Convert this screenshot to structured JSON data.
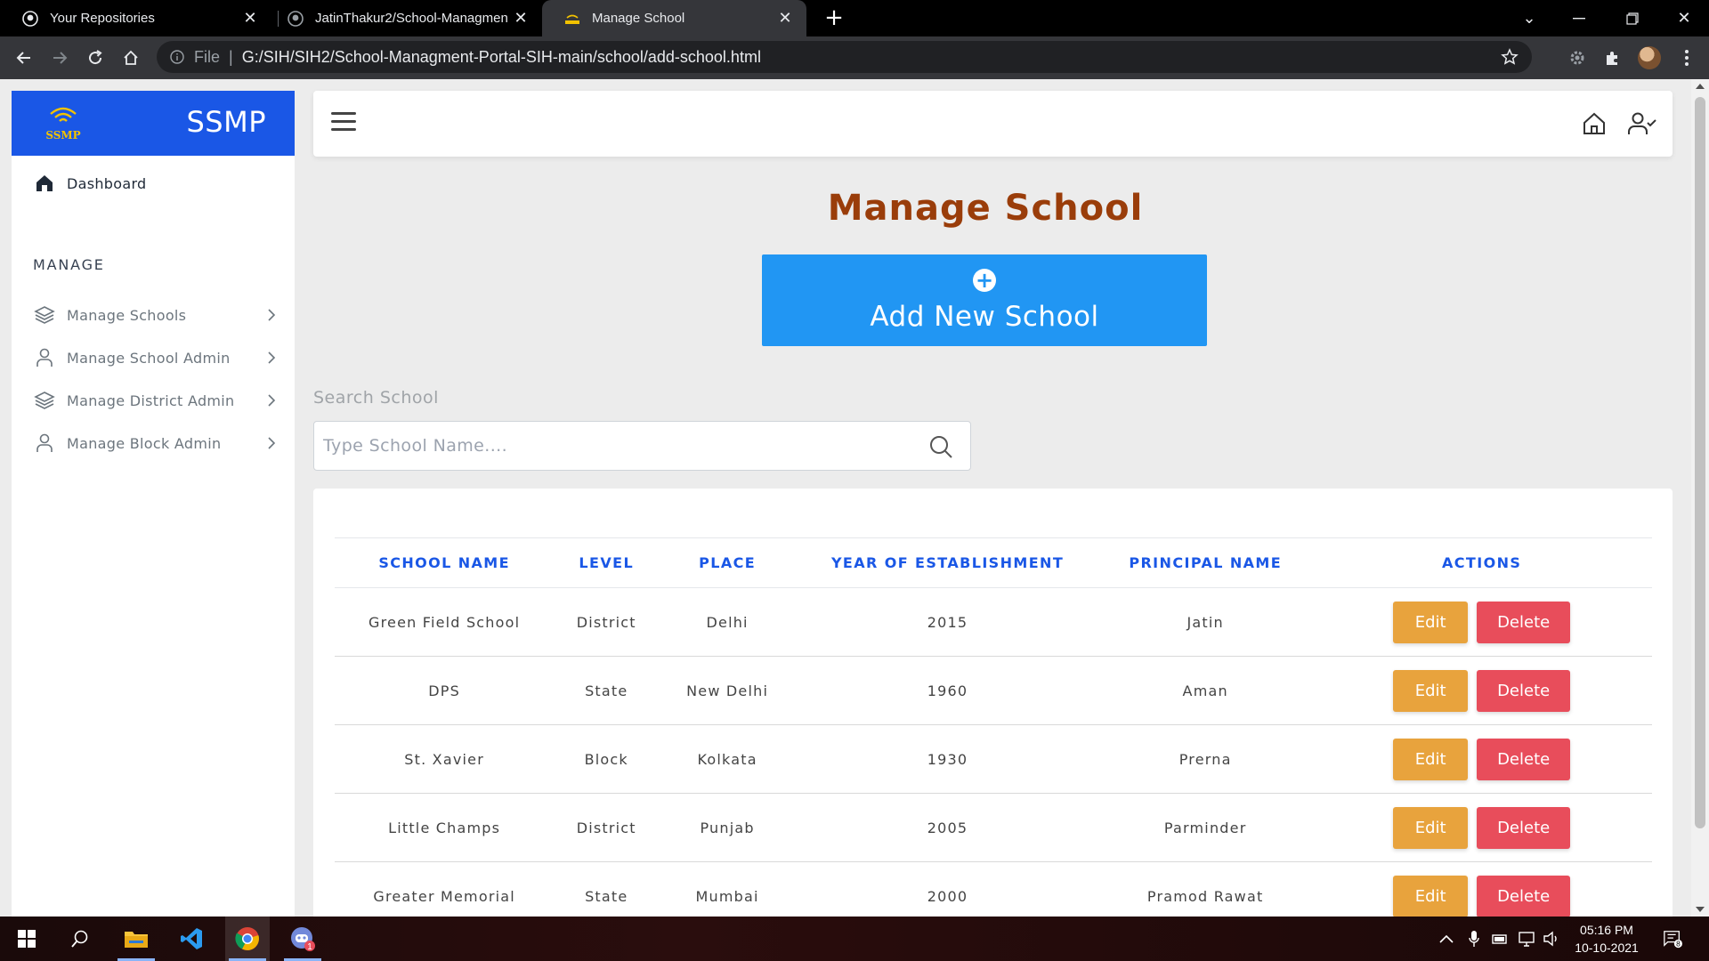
{
  "browser": {
    "tabs": [
      {
        "title": "Your Repositories",
        "icon": "github-icon"
      },
      {
        "title": "JatinThakur2/School-Managment",
        "icon": "github-icon"
      },
      {
        "title": "Manage School",
        "icon": "ssmp-favicon"
      }
    ],
    "protocol": "File",
    "url": "G:/SIH/SIH2/School-Managment-Portal-SIH-main/school/add-school.html"
  },
  "sidebar": {
    "brand": "SSMP",
    "logo_text": "SSMP",
    "dashboard": "Dashboard",
    "section": "MANAGE",
    "items": [
      {
        "label": "Manage Schools",
        "icon": "layers-icon"
      },
      {
        "label": "Manage School Admin",
        "icon": "user-icon"
      },
      {
        "label": "Manage District Admin",
        "icon": "layers-icon"
      },
      {
        "label": "Manage Block Admin",
        "icon": "user-icon"
      }
    ]
  },
  "main": {
    "title": "Manage School",
    "add_button": "Add New School",
    "search_label": "Search School",
    "search_placeholder": "Type School Name....",
    "table": {
      "headers": [
        "SCHOOL NAME",
        "LEVEL",
        "PLACE",
        "YEAR OF ESTABLISHMENT",
        "PRINCIPAL NAME",
        "ACTIONS"
      ],
      "rows": [
        [
          "Green Field School",
          "District",
          "Delhi",
          "2015",
          "Jatin"
        ],
        [
          "DPS",
          "State",
          "New Delhi",
          "1960",
          "Aman"
        ],
        [
          "St. Xavier",
          "Block",
          "Kolkata",
          "1930",
          "Prerna"
        ],
        [
          "Little Champs",
          "District",
          "Punjab",
          "2005",
          "Parminder"
        ],
        [
          "Greater Memorial",
          "State",
          "Mumbai",
          "2000",
          "Pramod Rawat"
        ]
      ],
      "edit_label": "Edit",
      "delete_label": "Delete"
    }
  },
  "taskbar": {
    "time": "05:16 PM",
    "date": "10-10-2021",
    "discord_badge": "1",
    "notification_count": "8"
  },
  "colors": {
    "brand_blue": "#1a57e6",
    "add_button": "#2196f3",
    "title": "#9a3d0a",
    "edit": "#e8a33d",
    "delete": "#e84d5b"
  }
}
